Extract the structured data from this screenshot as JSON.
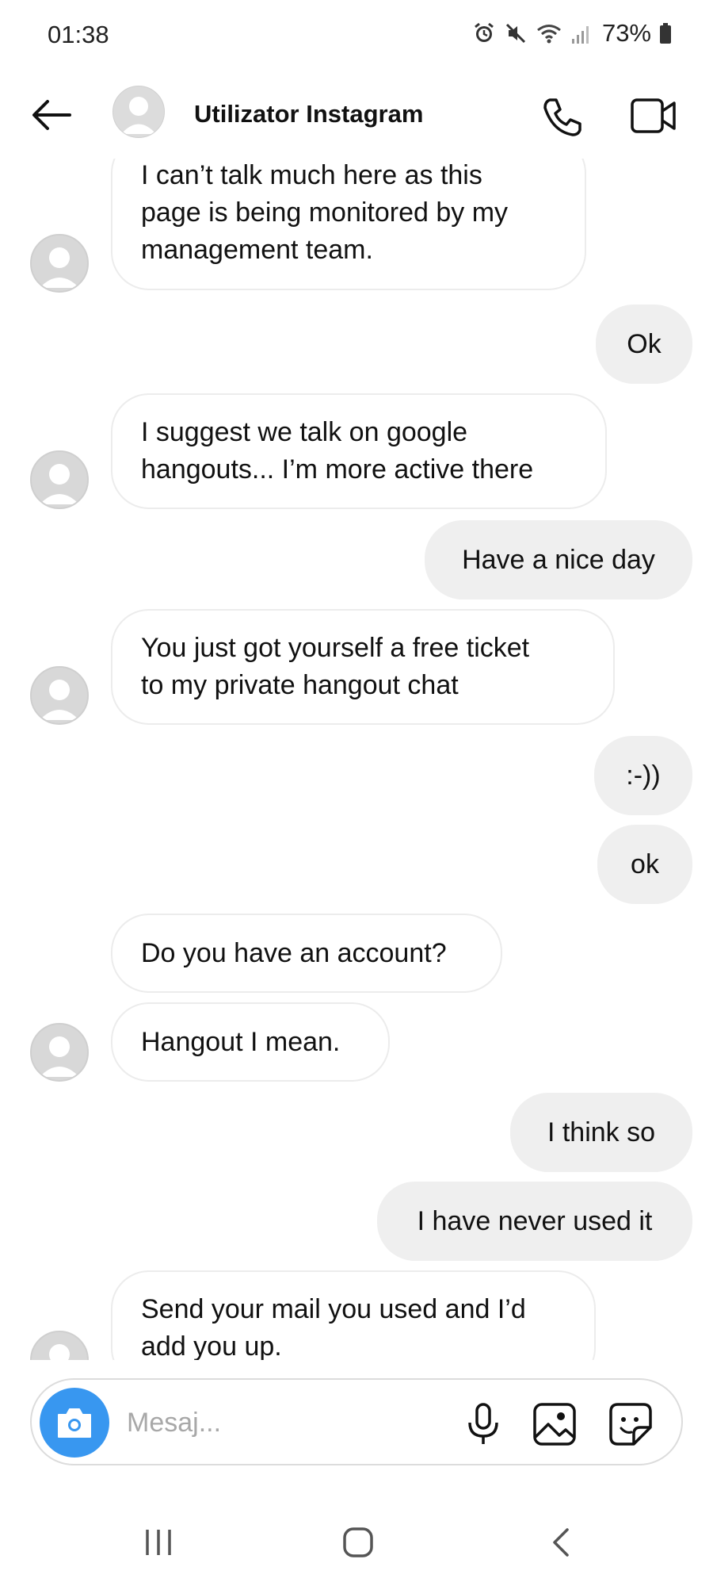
{
  "status_bar": {
    "time": "01:38",
    "battery": "73%"
  },
  "header": {
    "contact_name": "Utilizator Instagram"
  },
  "messages": [
    {
      "direction": "in",
      "lines": [
        "I can’t talk much here as this",
        "page is being monitored by my",
        "management team."
      ]
    },
    {
      "direction": "out",
      "lines": [
        "Ok"
      ]
    },
    {
      "direction": "in",
      "lines": [
        "I suggest we talk on google",
        "hangouts... I’m more active there"
      ]
    },
    {
      "direction": "out",
      "lines": [
        "Have a nice day"
      ]
    },
    {
      "direction": "in",
      "lines": [
        "You just got yourself a free ticket",
        "to my private hangout chat"
      ]
    },
    {
      "direction": "out",
      "lines": [
        ":-))"
      ]
    },
    {
      "direction": "out",
      "lines": [
        "ok"
      ]
    },
    {
      "direction": "in",
      "lines": [
        "Do you have an account?"
      ]
    },
    {
      "direction": "in",
      "lines": [
        "Hangout I mean."
      ]
    },
    {
      "direction": "out",
      "lines": [
        "I think so"
      ]
    },
    {
      "direction": "out",
      "lines": [
        "I have never used it"
      ]
    },
    {
      "direction": "in",
      "lines": [
        "Send your mail you used and I’d",
        "add you up."
      ]
    }
  ],
  "composer": {
    "placeholder": "Mesaj..."
  },
  "icons": {
    "back": "back-arrow-icon",
    "call": "phone-icon",
    "video": "video-camera-icon",
    "camera": "camera-icon",
    "mic": "microphone-icon",
    "gallery": "image-icon",
    "sticker": "sticker-icon"
  },
  "colors": {
    "accent": "#3897f0",
    "outgoing_bubble": "#efefef",
    "incoming_border": "#ececec"
  }
}
